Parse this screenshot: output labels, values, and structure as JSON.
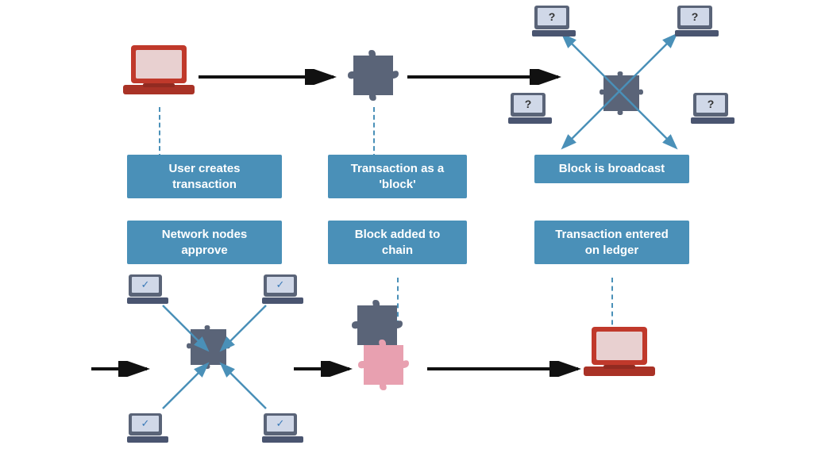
{
  "labels": {
    "user_creates": "User creates\ntransaction",
    "transaction_block": "Transaction as a\n'block'",
    "block_broadcast": "Block is broadcast",
    "network_nodes": "Network nodes\napprove",
    "block_added": "Block added to\nchain",
    "transaction_ledger": "Transaction entered\non ledger"
  },
  "colors": {
    "accent_blue": "#4a90b8",
    "laptop_red": "#c0392b",
    "laptop_dark_red": "#8b0000",
    "puzzle_dark": "#5a6478",
    "puzzle_pink": "#e8a0b0",
    "arrow_black": "#111111",
    "dashed_blue": "#4a90b8",
    "checkmark_blue": "#3a7ab8"
  }
}
